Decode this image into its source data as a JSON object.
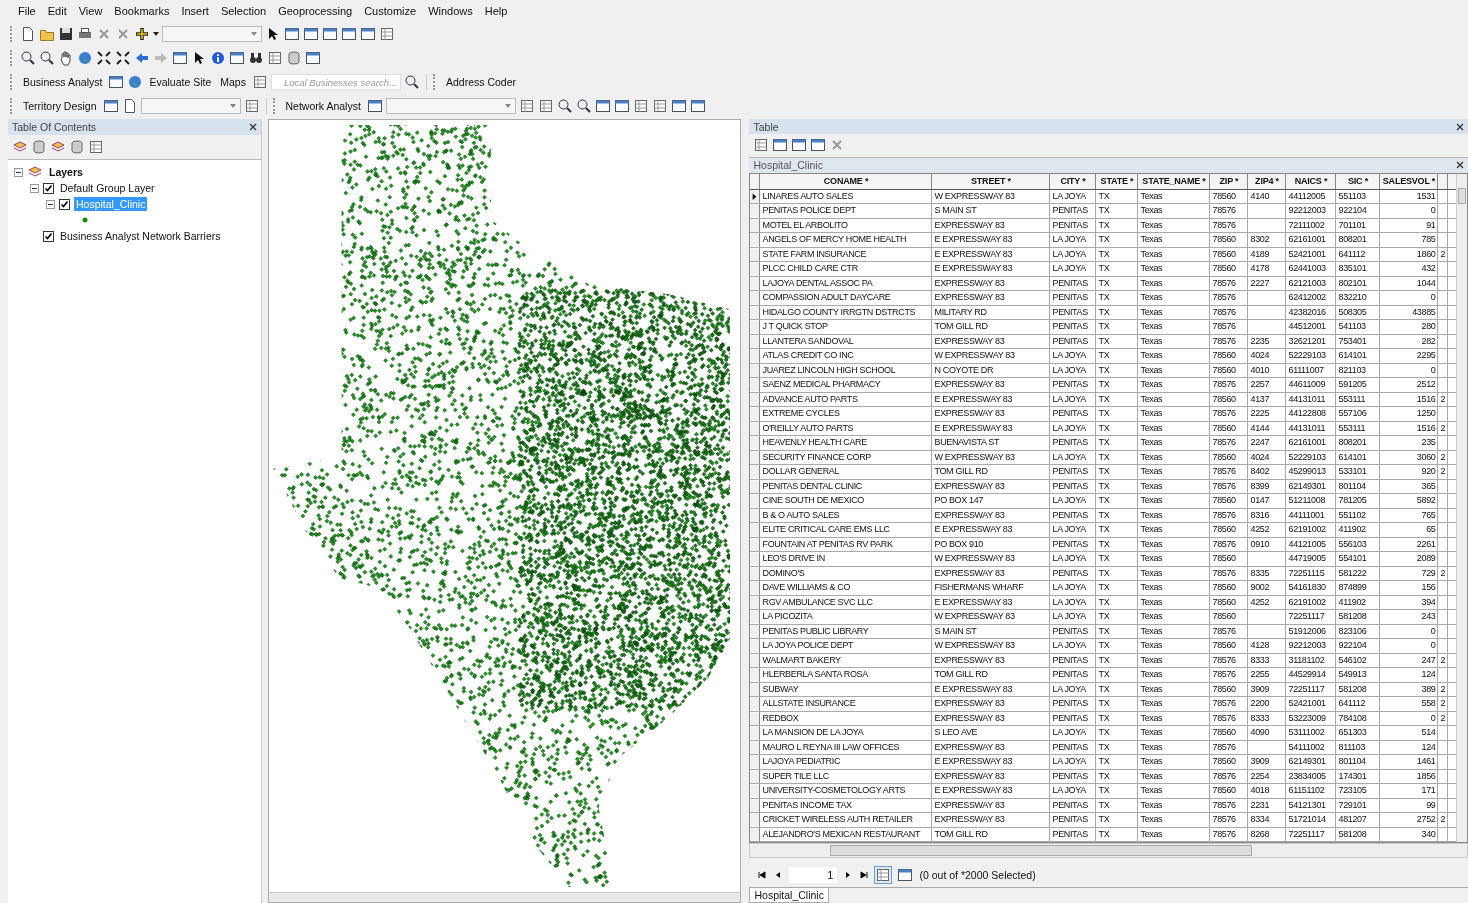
{
  "menu": [
    "File",
    "Edit",
    "View",
    "Bookmarks",
    "Insert",
    "Selection",
    "Geoprocessing",
    "Customize",
    "Windows",
    "Help"
  ],
  "toolbars": {
    "business_analyst": "Business Analyst",
    "evaluate_site": "Evaluate Site",
    "maps": "Maps",
    "search": {
      "placeholder": "Local Businesses search..."
    },
    "address_coder": "Address Coder",
    "territory_design": "Territory Design",
    "network_analyst": "Network Analyst"
  },
  "toc": {
    "title": "Table Of Contents",
    "tree": [
      {
        "label": "Layers",
        "expanded": true,
        "children": [
          {
            "label": "Default Group Layer",
            "checked": true,
            "selected": false,
            "expanded": true,
            "children": [
              {
                "label": "Hospital_Clinic",
                "checked": true,
                "selected": true,
                "expanded": true
              }
            ]
          },
          {
            "label": "Business Analyst Network Barriers",
            "checked": true,
            "selected": false
          }
        ]
      }
    ]
  },
  "table": {
    "panel_title": "Table",
    "layer_title": "Hospital_Clinic",
    "columns": [
      "CONAME *",
      "STREET *",
      "CITY *",
      "STATE *",
      "STATE_NAME *",
      "ZIP *",
      "ZIP4 *",
      "NAICS *",
      "SIC *",
      "SALESVOL *"
    ],
    "rows": [
      {
        "current": true,
        "cells": [
          "LINARES AUTO SALES",
          "W EXPRESSWAY 83",
          "LA JOYA",
          "TX",
          "Texas",
          "78560",
          "4140",
          "44112005",
          "551103",
          "1531"
        ]
      },
      {
        "current": false,
        "cells": [
          "PENITAS POLICE DEPT",
          "S MAIN ST",
          "PENITAS",
          "TX",
          "Texas",
          "78576",
          null,
          "92212003",
          "922104",
          "0"
        ]
      },
      {
        "current": false,
        "cells": [
          "MOTEL EL ARBOLITO",
          "EXPRESSWAY 83",
          "PENITAS",
          "TX",
          "Texas",
          "78576",
          null,
          "72111002",
          "701101",
          "91"
        ]
      },
      {
        "current": false,
        "cells": [
          "ANGELS OF MERCY HOME HEALTH",
          "E EXPRESSWAY 83",
          "LA JOYA",
          "TX",
          "Texas",
          "78560",
          "8302",
          "62161001",
          "808201",
          "785"
        ]
      },
      {
        "current": false,
        "cells": [
          "STATE FARM INSURANCE",
          "E EXPRESSWAY 83",
          "LA JOYA",
          "TX",
          "Texas",
          "78560",
          "4189",
          "52421001",
          "641112",
          "1860",
          "2"
        ]
      },
      {
        "current": false,
        "cells": [
          "PLCC CHILD CARE CTR",
          "E EXPRESSWAY 83",
          "LA JOYA",
          "TX",
          "Texas",
          "78560",
          "4178",
          "62441003",
          "835101",
          "432"
        ]
      },
      {
        "current": false,
        "cells": [
          "LAJOYA DENTAL ASSOC PA",
          "EXPRESSWAY 83",
          "PENITAS",
          "TX",
          "Texas",
          "78576",
          "2227",
          "62121003",
          "802101",
          "1044"
        ]
      },
      {
        "current": false,
        "cells": [
          "COMPASSION ADULT DAYCARE",
          "EXPRESSWAY 83",
          "PENITAS",
          "TX",
          "Texas",
          "78576",
          null,
          "62412002",
          "832210",
          "0"
        ]
      },
      {
        "current": false,
        "cells": [
          "HIDALGO COUNTY IRRGTN DSTRCTS",
          "MILITARY RD",
          "PENITAS",
          "TX",
          "Texas",
          "78576",
          null,
          "42382016",
          "508305",
          "43885"
        ]
      },
      {
        "current": false,
        "cells": [
          "J T QUICK STOP",
          "TOM GILL RD",
          "PENITAS",
          "TX",
          "Texas",
          "78576",
          null,
          "44512001",
          "541103",
          "280"
        ]
      },
      {
        "current": false,
        "cells": [
          "LLANTERA SANDOVAL",
          "EXPRESSWAY 83",
          "PENITAS",
          "TX",
          "Texas",
          "78576",
          "2235",
          "32621201",
          "753401",
          "282"
        ]
      },
      {
        "current": false,
        "cells": [
          "ATLAS CREDIT CO INC",
          "W EXPRESSWAY 83",
          "LA JOYA",
          "TX",
          "Texas",
          "78560",
          "4024",
          "52229103",
          "614101",
          "2295"
        ]
      },
      {
        "current": false,
        "cells": [
          "JUAREZ LINCOLN HIGH SCHOOL",
          "N COYOTE DR",
          "LA JOYA",
          "TX",
          "Texas",
          "78560",
          "4010",
          "61111007",
          "821103",
          "0"
        ]
      },
      {
        "current": false,
        "cells": [
          "SAENZ MEDICAL PHARMACY",
          "EXPRESSWAY 83",
          "PENITAS",
          "TX",
          "Texas",
          "78576",
          "2257",
          "44611009",
          "591205",
          "2512"
        ]
      },
      {
        "current": false,
        "cells": [
          "ADVANCE AUTO PARTS",
          "E EXPRESSWAY 83",
          "LA JOYA",
          "TX",
          "Texas",
          "78560",
          "4137",
          "44131011",
          "553111",
          "1516",
          "2"
        ]
      },
      {
        "current": false,
        "cells": [
          "EXTREME CYCLES",
          "EXPRESSWAY 83",
          "PENITAS",
          "TX",
          "Texas",
          "78576",
          "2225",
          "44122808",
          "557106",
          "1250"
        ]
      },
      {
        "current": false,
        "cells": [
          "O'REILLY AUTO PARTS",
          "E EXPRESSWAY 83",
          "LA JOYA",
          "TX",
          "Texas",
          "78560",
          "4144",
          "44131011",
          "553111",
          "1516",
          "2"
        ]
      },
      {
        "current": false,
        "cells": [
          "HEAVENLY HEALTH CARE",
          "BUENAVISTA ST",
          "PENITAS",
          "TX",
          "Texas",
          "78576",
          "2247",
          "62161001",
          "808201",
          "235"
        ]
      },
      {
        "current": false,
        "cells": [
          "SECURITY FINANCE CORP",
          "W EXPRESSWAY 83",
          "LA JOYA",
          "TX",
          "Texas",
          "78560",
          "4024",
          "52229103",
          "614101",
          "3060",
          "2"
        ]
      },
      {
        "current": false,
        "cells": [
          "DOLLAR GENERAL",
          "TOM GILL RD",
          "PENITAS",
          "TX",
          "Texas",
          "78576",
          "8402",
          "45299013",
          "533101",
          "920",
          "2"
        ]
      },
      {
        "current": false,
        "cells": [
          "PENITAS DENTAL CLINIC",
          "EXPRESSWAY 83",
          "PENITAS",
          "TX",
          "Texas",
          "78576",
          "8399",
          "62149301",
          "801104",
          "365"
        ]
      },
      {
        "current": false,
        "cells": [
          "CINE SOUTH DE MEXICO",
          "PO BOX 147",
          "LA JOYA",
          "TX",
          "Texas",
          "78560",
          "0147",
          "51211008",
          "781205",
          "5892"
        ]
      },
      {
        "current": false,
        "cells": [
          "B & O AUTO SALES",
          "EXPRESSWAY 83",
          "PENITAS",
          "TX",
          "Texas",
          "78576",
          "8316",
          "44111001",
          "551102",
          "765"
        ]
      },
      {
        "current": false,
        "cells": [
          "ELITE CRITICAL CARE EMS LLC",
          "E EXPRESSWAY 83",
          "LA JOYA",
          "TX",
          "Texas",
          "78560",
          "4252",
          "62191002",
          "411902",
          "65"
        ]
      },
      {
        "current": false,
        "cells": [
          "FOUNTAIN AT PENITAS RV PARK",
          "PO BOX 910",
          "PENITAS",
          "TX",
          "Texas",
          "78576",
          "0910",
          "44121005",
          "556103",
          "2261"
        ]
      },
      {
        "current": false,
        "cells": [
          "LEO'S DRIVE IN",
          "W EXPRESSWAY 83",
          "LA JOYA",
          "TX",
          "Texas",
          "78560",
          null,
          "44719005",
          "554101",
          "2089"
        ]
      },
      {
        "current": false,
        "cells": [
          "DOMINO'S",
          "EXPRESSWAY 83",
          "PENITAS",
          "TX",
          "Texas",
          "78576",
          "8335",
          "72251115",
          "581222",
          "729",
          "2"
        ]
      },
      {
        "current": false,
        "cells": [
          "DAVE WILLIAMS & CO",
          "FISHERMANS WHARF",
          "LA JOYA",
          "TX",
          "Texas",
          "78560",
          "9002",
          "54161830",
          "874899",
          "156"
        ]
      },
      {
        "current": false,
        "cells": [
          "RGV AMBULANCE SVC LLC",
          "E EXPRESSWAY 83",
          "LA JOYA",
          "TX",
          "Texas",
          "78560",
          "4252",
          "62191002",
          "411902",
          "394"
        ]
      },
      {
        "current": false,
        "cells": [
          "LA PICOZITA",
          "W EXPRESSWAY 83",
          "LA JOYA",
          "TX",
          "Texas",
          "78560",
          null,
          "72251117",
          "581208",
          "243"
        ]
      },
      {
        "current": false,
        "cells": [
          "PENITAS PUBLIC LIBRARY",
          "S MAIN ST",
          "PENITAS",
          "TX",
          "Texas",
          "78576",
          null,
          "51912006",
          "823106",
          "0"
        ]
      },
      {
        "current": false,
        "cells": [
          "LA JOYA POLICE DEPT",
          "W EXPRESSWAY 83",
          "LA JOYA",
          "TX",
          "Texas",
          "78560",
          "4128",
          "92212003",
          "922104",
          "0"
        ]
      },
      {
        "current": false,
        "cells": [
          "WALMART BAKERY",
          "EXPRESSWAY 83",
          "PENITAS",
          "TX",
          "Texas",
          "78576",
          "8333",
          "31181102",
          "546102",
          "247",
          "2"
        ]
      },
      {
        "current": false,
        "cells": [
          "HLERBERLA SANTA ROSA",
          "TOM GILL RD",
          "PENITAS",
          "TX",
          "Texas",
          "78576",
          "2255",
          "44529914",
          "549913",
          "124"
        ]
      },
      {
        "current": false,
        "cells": [
          "SUBWAY",
          "E EXPRESSWAY 83",
          "LA JOYA",
          "TX",
          "Texas",
          "78560",
          "3909",
          "72251117",
          "581208",
          "389",
          "2"
        ]
      },
      {
        "current": false,
        "cells": [
          "ALLSTATE INSURANCE",
          "EXPRESSWAY 83",
          "PENITAS",
          "TX",
          "Texas",
          "78576",
          "2200",
          "52421001",
          "641112",
          "558",
          "2"
        ]
      },
      {
        "current": false,
        "cells": [
          "REDBOX",
          "EXPRESSWAY 83",
          "PENITAS",
          "TX",
          "Texas",
          "78576",
          "8333",
          "53223009",
          "784108",
          "0",
          "2"
        ]
      },
      {
        "current": false,
        "cells": [
          "LA MANSION DE LA JOYA",
          "S LEO AVE",
          "LA JOYA",
          "TX",
          "Texas",
          "78560",
          "4090",
          "53111002",
          "651303",
          "514"
        ]
      },
      {
        "current": false,
        "cells": [
          "MAURO L REYNA III LAW OFFICES",
          "EXPRESSWAY 83",
          "PENITAS",
          "TX",
          "Texas",
          "78576",
          null,
          "54111002",
          "811103",
          "124"
        ]
      },
      {
        "current": false,
        "cells": [
          "LAJOYA PEDIATRIC",
          "E EXPRESSWAY 83",
          "LA JOYA",
          "TX",
          "Texas",
          "78560",
          "3909",
          "62149301",
          "801104",
          "1461"
        ]
      },
      {
        "current": false,
        "cells": [
          "SUPER TILE LLC",
          "EXPRESSWAY 83",
          "PENITAS",
          "TX",
          "Texas",
          "78576",
          "2254",
          "23834005",
          "174301",
          "1856"
        ]
      },
      {
        "current": false,
        "cells": [
          "UNIVERSITY-COSMETOLOGY ARTS",
          "E EXPRESSWAY 83",
          "LA JOYA",
          "TX",
          "Texas",
          "78560",
          "4018",
          "61151102",
          "723105",
          "171"
        ]
      },
      {
        "current": false,
        "cells": [
          "PENITAS INCOME TAX",
          "EXPRESSWAY 83",
          "PENITAS",
          "TX",
          "Texas",
          "78576",
          "2231",
          "54121301",
          "729101",
          "99"
        ]
      },
      {
        "current": false,
        "cells": [
          "CRICKET WIRELESS AUTH RETAILER",
          "EXPRESSWAY 83",
          "PENITAS",
          "TX",
          "Texas",
          "78576",
          "8334",
          "51721014",
          "481207",
          "2752",
          "2"
        ]
      },
      {
        "current": false,
        "cells": [
          "ALEJANDRO'S MEXICAN RESTAURANT",
          "TOM GILL RD",
          "PENITAS",
          "TX",
          "Texas",
          "78576",
          "8268",
          "72251117",
          "581208",
          "340"
        ]
      }
    ],
    "record": "1",
    "status": "(0 out of *2000 Selected)",
    "tab": "Hospital_Clinic"
  }
}
